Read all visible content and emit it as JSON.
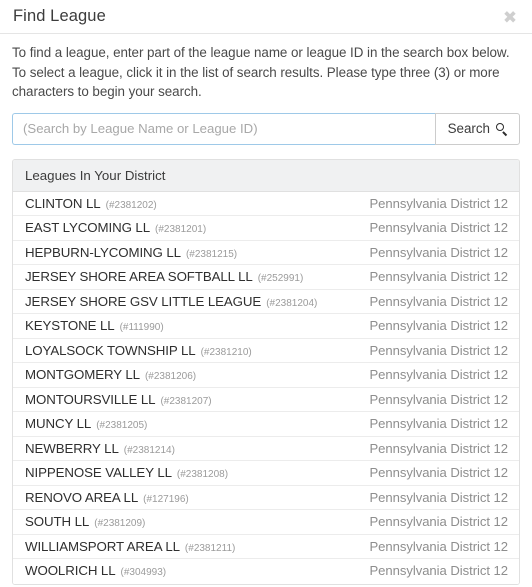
{
  "dialog": {
    "title": "Find League",
    "close_icon": "close-icon",
    "intro": "To find a league, enter part of the league name or league ID in the search box below. To select a league, click it in the list of search results. Please type three (3) or more characters to begin your search."
  },
  "search": {
    "value": "",
    "placeholder": "(Search by League Name or League ID)",
    "button_label": "Search",
    "button_icon": "magnifier-icon",
    "focus_border_color": "#9ec9e8"
  },
  "results": {
    "header": "Leagues In Your District",
    "rows": [
      {
        "name": "CLINTON LL",
        "id": "(#2381202)",
        "district": "Pennsylvania District 12"
      },
      {
        "name": "EAST LYCOMING LL",
        "id": "(#2381201)",
        "district": "Pennsylvania District 12"
      },
      {
        "name": "HEPBURN-LYCOMING LL",
        "id": "(#2381215)",
        "district": "Pennsylvania District 12"
      },
      {
        "name": "JERSEY SHORE AREA SOFTBALL LL",
        "id": "(#252991)",
        "district": "Pennsylvania District 12"
      },
      {
        "name": "JERSEY SHORE GSV LITTLE LEAGUE",
        "id": "(#2381204)",
        "district": "Pennsylvania District 12"
      },
      {
        "name": "KEYSTONE LL",
        "id": "(#111990)",
        "district": "Pennsylvania District 12"
      },
      {
        "name": "LOYALSOCK TOWNSHIP LL",
        "id": "(#2381210)",
        "district": "Pennsylvania District 12"
      },
      {
        "name": "MONTGOMERY LL",
        "id": "(#2381206)",
        "district": "Pennsylvania District 12"
      },
      {
        "name": "MONTOURSVILLE LL",
        "id": "(#2381207)",
        "district": "Pennsylvania District 12"
      },
      {
        "name": "MUNCY LL",
        "id": "(#2381205)",
        "district": "Pennsylvania District 12"
      },
      {
        "name": "NEWBERRY LL",
        "id": "(#2381214)",
        "district": "Pennsylvania District 12"
      },
      {
        "name": "NIPPENOSE VALLEY LL",
        "id": "(#2381208)",
        "district": "Pennsylvania District 12"
      },
      {
        "name": "RENOVO AREA LL",
        "id": "(#127196)",
        "district": "Pennsylvania District 12"
      },
      {
        "name": "SOUTH LL",
        "id": "(#2381209)",
        "district": "Pennsylvania District 12"
      },
      {
        "name": "WILLIAMSPORT AREA LL",
        "id": "(#2381211)",
        "district": "Pennsylvania District 12"
      },
      {
        "name": "WOOLRICH LL",
        "id": "(#304993)",
        "district": "Pennsylvania District 12"
      }
    ]
  }
}
